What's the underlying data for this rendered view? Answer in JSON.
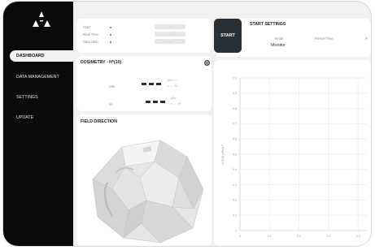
{
  "sidebar": {
    "items": [
      {
        "label": "DASHBOARD",
        "active": true
      },
      {
        "label": "DATA MANAGEMENT",
        "active": false
      },
      {
        "label": "SETTINGS",
        "active": false
      },
      {
        "label": "UPDATE",
        "active": false
      }
    ]
  },
  "status": {
    "rows": [
      {
        "label": "Start",
        "value": "-----"
      },
      {
        "label": "Real Time",
        "value": "-----"
      },
      {
        "label": "Data UNC",
        "value": "-----"
      }
    ]
  },
  "start_settings": {
    "title": "START SETTINGS",
    "start_label": "START",
    "columns": [
      {
        "label": "Mode",
        "value": "Monitor"
      },
      {
        "label": "Preset-Time",
        "value": ""
      },
      {
        "label": "P",
        "value": ""
      }
    ]
  },
  "dosimetry": {
    "title": "DOSIMETRY - H*(10)",
    "rows": [
      {
        "label": "rate",
        "value": "— — —",
        "unit_top": "µSv h⁻¹",
        "unit_bot": "± - - - %"
      },
      {
        "label": "int.",
        "value": "— — —",
        "unit_top": "µSv",
        "unit_bot": "± - - - %"
      }
    ]
  },
  "field_direction": {
    "title": "FIELD DIRECTION"
  },
  "chart_data": {
    "type": "line",
    "title": "",
    "xlabel": "",
    "ylabel": "H*(10) µSv h⁻¹",
    "x_ticks": [
      "0",
      "0.1",
      "0.2",
      "0.3",
      "0.4"
    ],
    "y_ticks": [
      "1.0",
      "0.9",
      "0.8",
      "0.7",
      "0.6",
      "0.5",
      "0.4",
      "0.3",
      "0.2",
      "0.1",
      "0"
    ],
    "xlim": [
      0,
      0.4
    ],
    "ylim": [
      0,
      1.0
    ],
    "grid": true,
    "series": []
  }
}
